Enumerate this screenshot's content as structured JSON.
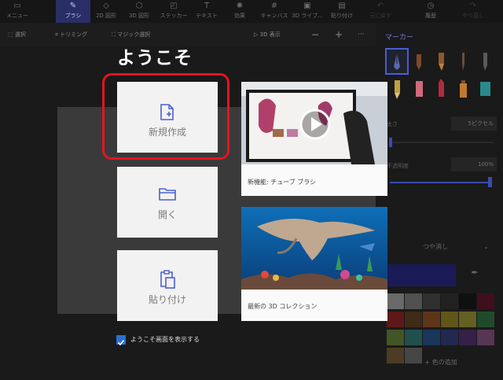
{
  "topbar": {
    "items": [
      {
        "label": "メニュー",
        "icon": "menu-icon"
      },
      {
        "label": "ブラシ",
        "icon": "brush-icon"
      },
      {
        "label": "2D 図形",
        "icon": "2d-shapes-icon"
      },
      {
        "label": "3D 図形",
        "icon": "3d-shapes-icon"
      },
      {
        "label": "ステッカー",
        "icon": "sticker-icon"
      },
      {
        "label": "テキスト",
        "icon": "text-icon"
      },
      {
        "label": "効果",
        "icon": "effects-icon"
      },
      {
        "label": "キャンバス",
        "icon": "canvas-icon"
      },
      {
        "label": "3D ライブ...",
        "icon": "3d-library-icon"
      },
      {
        "label": "貼り付け",
        "icon": "paste-icon"
      },
      {
        "label": "元に戻す",
        "icon": "undo-icon"
      },
      {
        "label": "履歴",
        "icon": "history-icon"
      },
      {
        "label": "やり直し",
        "icon": "redo-icon"
      }
    ],
    "active": "ブラシ"
  },
  "toolbar2": {
    "select": "選択",
    "crop": "トリミング",
    "magic_select": "マジック選択",
    "view3d": "3D 表示",
    "zoom_out": "−",
    "zoom_in": "+",
    "more": "···"
  },
  "panel": {
    "title": "マーカー",
    "size_label": "太さ",
    "size_value": "5ピクセル",
    "opacity_label": "不透明度",
    "opacity_value": "100%",
    "finish": "つや消し",
    "add_color": "色の追加",
    "brushes": [
      "calligraphy-pen",
      "marker",
      "oil-brush",
      "watercolor",
      "pixel-pen",
      "pencil",
      "eraser",
      "crayon",
      "spraycan",
      "fill"
    ],
    "colors": [
      "#ffffff",
      "#bbbbbb",
      "#5b5b5b",
      "#323232",
      "#000000",
      "#800020",
      "#e01818",
      "#8a4b16",
      "#e36b1c",
      "#e6c817",
      "#f0e63a",
      "#2ea84d",
      "#8ec63f",
      "#2db6b0",
      "#1e6ecf",
      "#3346b8",
      "#6a2f9e",
      "#c86ec0",
      "#b07a3d",
      "#9a9a9a"
    ],
    "accent": "#4a5dcf"
  },
  "welcome": {
    "title": "ようこそ",
    "new": "新規作成",
    "open": "開く",
    "paste": "貼り付け",
    "card1": "新機能: チューブ ブラシ",
    "card2": "最新の 3D コレクション",
    "show_on_start": "ようこそ画面を表示する"
  }
}
